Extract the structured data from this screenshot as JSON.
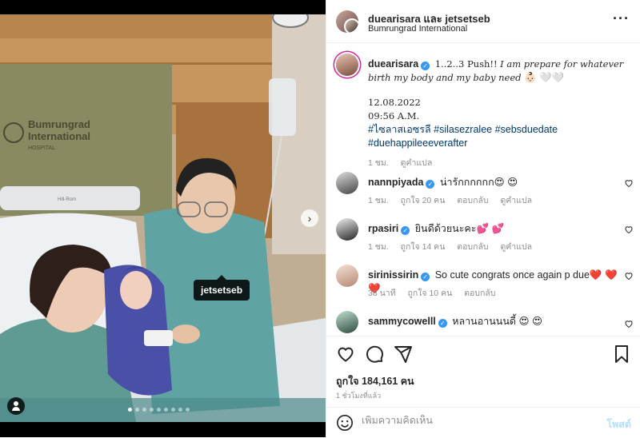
{
  "header": {
    "username": "duearisara และ jetsetseb",
    "location": "Bumrungrad International"
  },
  "media": {
    "tag_label": "jetsetseb",
    "slide_count": 9,
    "active_slide": 1,
    "hospital_sign": [
      "Bumrungrad",
      "International",
      "HOSPITAL"
    ],
    "monitor_label": "Hill-Rom"
  },
  "caption": {
    "username": "duearisara",
    "text_start": "1..2..3 Push!!",
    "text_italic": "I am prepare for whatever birth my body and my baby need",
    "text_emoji": "👶🏻 🤍🤍",
    "date": "12.08.2022",
    "time": "09:56 A.M.",
    "hashtags_line1": "#ไซลาสเอซรลี #silasezralee #sebsduedate",
    "hashtags_line2": "#duehappileeeverafter",
    "meta_age": "1 ชม.",
    "meta_translate": "ดูคำแปล"
  },
  "comments": [
    {
      "username": "nannpiyada",
      "text": "น่ารักกกกกก😍 😍",
      "age": "1 ชม.",
      "likes": "ถูกใจ 20 คน",
      "reply": "ตอบกลับ",
      "translate": "ดูคำแปล"
    },
    {
      "username": "rpasiri",
      "text": "ยินดีด้วยนะคะ💕 💕",
      "age": "1 ชม.",
      "likes": "ถูกใจ 14 คน",
      "reply": "ตอบกลับ",
      "translate": "ดูคำแปล"
    },
    {
      "username": "sirinissirin",
      "text": "So cute congrats once again p due❤️ ❤️ ❤️",
      "age": "38 นาที",
      "likes": "ถูกใจ 10 คน",
      "reply": "ตอบกลับ",
      "translate": ""
    },
    {
      "username": "sammycowelll",
      "text": "หลานอานนนดี้ 😍 😍",
      "age": "",
      "likes": "",
      "reply": "",
      "translate": ""
    }
  ],
  "actions": {
    "likes_text": "ถูกใจ 184,161 คน",
    "posted_time": "1 ชั่วโมงที่แล้ว"
  },
  "composer": {
    "placeholder": "เพิ่มความคิดเห็น",
    "post_label": "โพสต์"
  },
  "colors": {
    "link": "#00376b",
    "verified": "#3897f0",
    "post_disabled": "#b2dffc",
    "muted": "#8e8e8e"
  },
  "icons": [
    "heart-icon",
    "comment-icon",
    "share-icon",
    "bookmark-icon",
    "emoji-icon",
    "more-icon",
    "next-arrow-icon",
    "user-tag-icon",
    "verified-icon"
  ]
}
